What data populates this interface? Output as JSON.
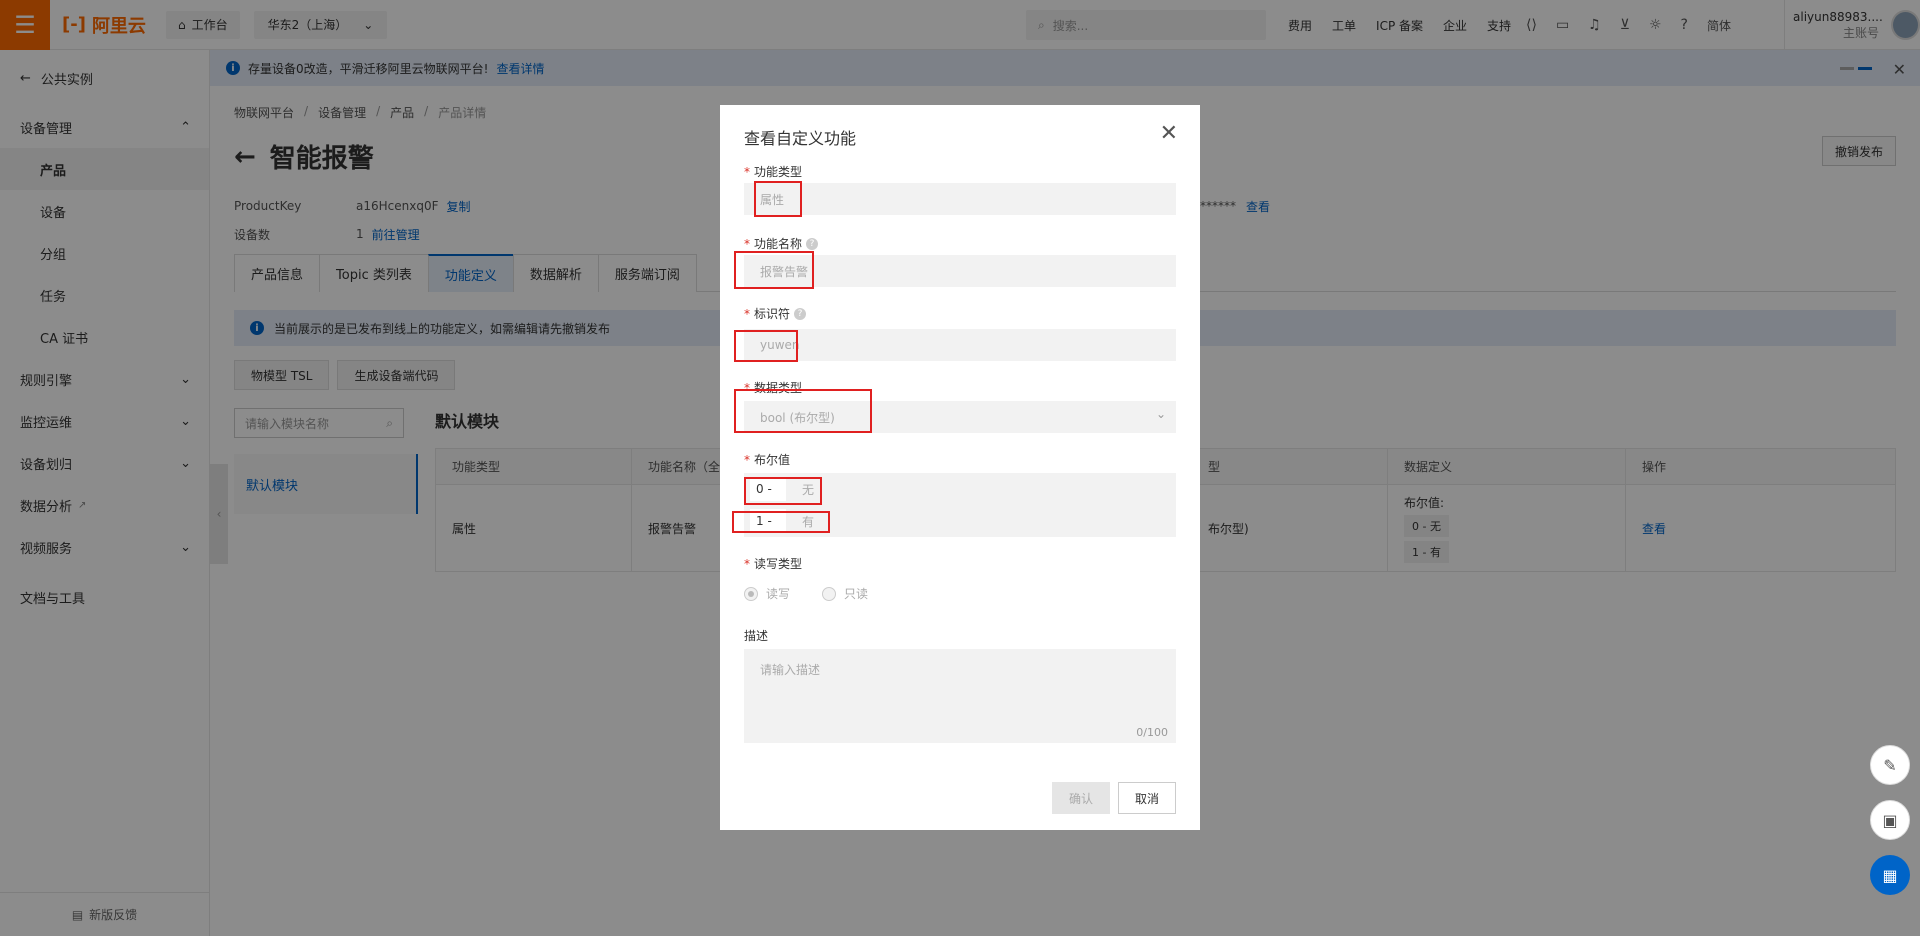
{
  "topbar": {
    "logo_text": "阿里云",
    "workbench": "工作台",
    "region": "华东2（上海）",
    "search_placeholder": "搜索...",
    "links": [
      "费用",
      "工单",
      "ICP 备案",
      "企业",
      "支持"
    ],
    "lang": "简体",
    "user_name": "aliyun88983....",
    "user_role": "主账号"
  },
  "notice": {
    "text": "存量设备0改造，平滑迁移阿里云物联网平台!",
    "link": "查看详情"
  },
  "sidebar": {
    "back": "公共实例",
    "group_device": "设备管理",
    "items": [
      "产品",
      "设备",
      "分组",
      "任务",
      "CA 证书"
    ],
    "groups": [
      "规则引擎",
      "监控运维",
      "设备划归",
      "数据分析",
      "视频服务",
      "文档与工具"
    ],
    "footer": "新版反馈"
  },
  "main": {
    "breadcrumb": [
      "物联网平台",
      "产品",
      "产品",
      "产品详情"
    ],
    "title": "智能报警",
    "revoke_button": "撤销发布",
    "product_key_label": "ProductKey",
    "product_key_value": "a16Hcenxq0F",
    "copy_link": "复制",
    "device_count_label": "设备数",
    "device_count_value": "1",
    "manage_link": "前往管理",
    "secret_mask": "******",
    "view_link": "查看",
    "tabs": [
      "产品信息",
      "Topic 类列表",
      "功能定义",
      "数据解析",
      "服务端订阅"
    ],
    "tip": "当前展示的是已发布到线上的功能定义，如需编辑请先撤销发布",
    "tsl_button": "物模型 TSL",
    "gen_code_button": "生成设备端代码",
    "module_search_placeholder": "请输入模块名称",
    "module_item": "默认模块",
    "module_title": "默认模块",
    "table": {
      "headers": [
        "功能类型",
        "功能名称（全",
        "",
        "型",
        "数据定义",
        "操作"
      ],
      "row": {
        "type": "属性",
        "name": "报警告警",
        "data_type": "布尔型)",
        "def_label": "布尔值:",
        "def_0": "0 - 无",
        "def_1": "1 - 有",
        "action": "查看"
      }
    }
  },
  "modal": {
    "title": "查看自定义功能",
    "type_label": "功能类型",
    "type_value": "属性",
    "name_label": "功能名称",
    "name_value": "报警告警",
    "id_label": "标识符",
    "id_value": "yuwen",
    "dtype_label": "数据类型",
    "dtype_value": "bool (布尔型)",
    "bool_label": "布尔值",
    "bool_0_key": "0 -",
    "bool_0_val": "无",
    "bool_1_key": "1 -",
    "bool_1_val": "有",
    "rw_label": "读写类型",
    "rw_options": [
      "读写",
      "只读"
    ],
    "desc_label": "描述",
    "desc_placeholder": "请输入描述",
    "desc_count": "0/100",
    "confirm": "确认",
    "cancel": "取消"
  },
  "colors": {
    "brand": "#ff6a00",
    "link": "#0064c8",
    "highlight": "#e02020"
  }
}
